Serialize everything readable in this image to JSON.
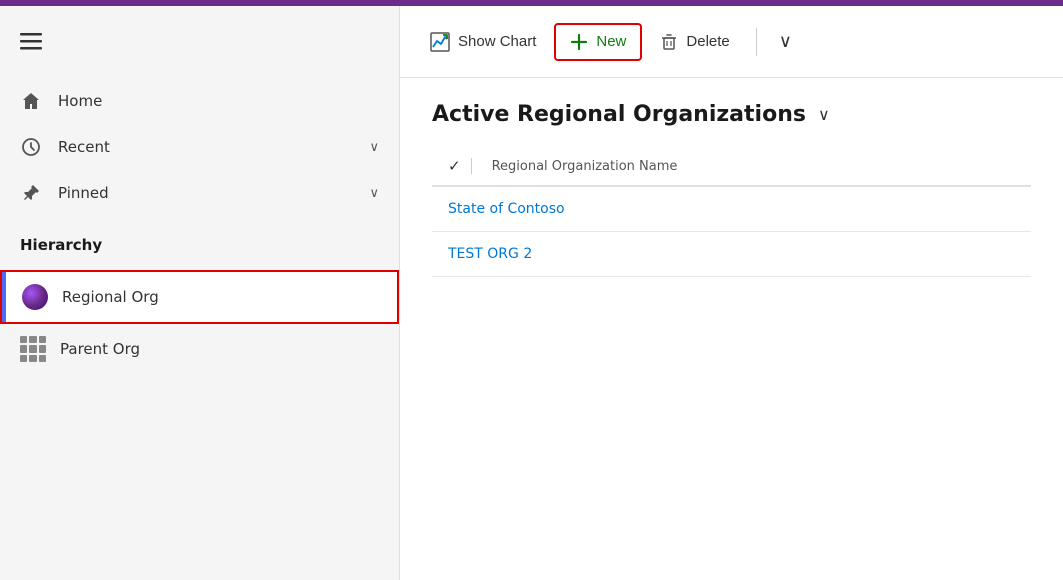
{
  "topBar": {},
  "sidebar": {
    "hamburgerLabel": "Menu",
    "navItems": [
      {
        "id": "home",
        "label": "Home",
        "icon": "home-icon",
        "hasChevron": false
      },
      {
        "id": "recent",
        "label": "Recent",
        "icon": "recent-icon",
        "hasChevron": true
      },
      {
        "id": "pinned",
        "label": "Pinned",
        "icon": "pin-icon",
        "hasChevron": true
      }
    ],
    "hierarchyLabel": "Hierarchy",
    "hierarchyItems": [
      {
        "id": "regional-org",
        "label": "Regional Org",
        "icon": "regional-org-icon",
        "selected": true
      },
      {
        "id": "parent-org",
        "label": "Parent Org",
        "icon": "parent-org-icon",
        "selected": false
      }
    ]
  },
  "toolbar": {
    "showChartLabel": "Show Chart",
    "newLabel": "New",
    "deleteLabel": "Delete",
    "moreLabel": "More options"
  },
  "mainContent": {
    "viewTitle": "Active Regional Organizations",
    "tableColumns": [
      {
        "id": "name",
        "label": "Regional Organization Name"
      }
    ],
    "tableRows": [
      {
        "id": "row1",
        "name": "State of Contoso"
      },
      {
        "id": "row2",
        "name": "TEST ORG 2"
      }
    ]
  }
}
